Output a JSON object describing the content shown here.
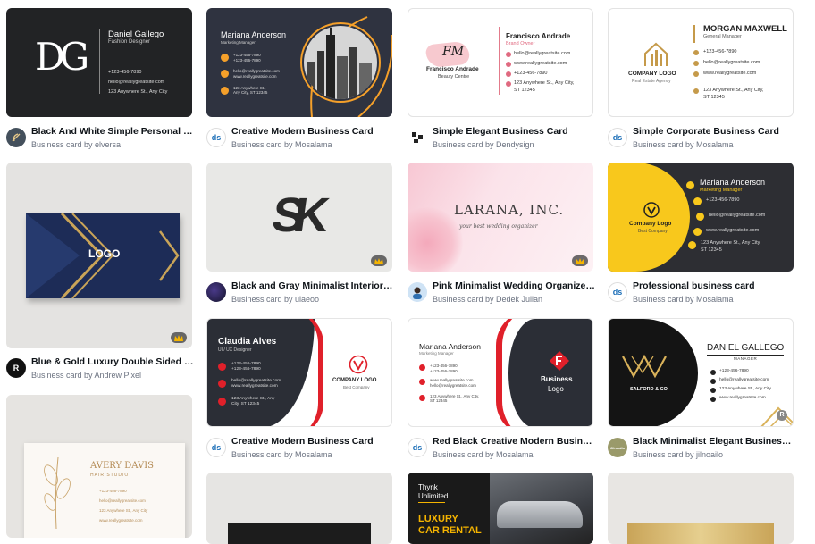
{
  "cards": [
    {
      "title": "Black And White Simple Personal Bu...",
      "byline": "Business card by elversa",
      "avatar": "elversa-avatar"
    },
    {
      "title": "Creative Modern Business Card",
      "byline": "Business card by Mosalama",
      "avatar": "ds-avatar"
    },
    {
      "title": "Simple Elegant Business Card",
      "byline": "Business card by Dendysign",
      "avatar": "dendysign-avatar"
    },
    {
      "title": "Simple Corporate Business Card",
      "byline": "Business card by Mosalama",
      "avatar": "ds-avatar"
    },
    {
      "title": "Blue & Gold Luxury Double Sided Bu...",
      "byline": "Business card by Andrew Pixel",
      "avatar": "r-avatar"
    },
    {
      "title": "Black and Gray Minimalist Interior D...",
      "byline": "Business card by uiaeoo",
      "avatar": "uiaeoo-avatar"
    },
    {
      "title": "Pink Minimalist Wedding Organizer ...",
      "byline": "Business card by Dedek Julian",
      "avatar": "dedek-avatar"
    },
    {
      "title": "Professional business card",
      "byline": "Business card by Mosalama",
      "avatar": "ds-avatar"
    },
    {
      "title": "Creative Modern Business Card",
      "byline": "Business card by Mosalama",
      "avatar": "ds-avatar"
    },
    {
      "title": "Red Black Creative Modern Business...",
      "byline": "Business card by Mosalama",
      "avatar": "ds-avatar"
    },
    {
      "title": "Black Minimalist Elegant Business C...",
      "byline": "Business card by jilnoailo",
      "avatar": "jilnoailo-avatar"
    }
  ],
  "avatars": {
    "ds": "ds",
    "r": "R",
    "jil": "Jilnoailo"
  },
  "thumb1": {
    "mono": "DG",
    "name": "Daniel Gallego",
    "role": "Fashion Designer",
    "phone": "+123-456-7890",
    "email": "hello@reallygreatsite.com",
    "addr": "123 Anywhere St., Any City"
  },
  "thumb2": {
    "name": "Mariana Anderson",
    "role": "Marketing Manager",
    "l1": "+123-456-7890",
    "l2": "+123-456-7890",
    "l3": "hello@reallygreatsite.com",
    "l4": "www.reallygreatsite.com",
    "l5": "123 Anywhere St., Any City, ST 12345"
  },
  "thumb3": {
    "mono": "FM",
    "brand": "Francisco Andrade",
    "tag": "Beauty Centre",
    "name": "Francisco Andrade",
    "role": "Brand Owner",
    "email": "hello@reallygreatsite.com",
    "web": "www.reallygreatsite.com",
    "phone": "+123-456-7890",
    "addr1": "123 Anywhere St., Any City,",
    "addr2": "ST 12345"
  },
  "thumb4": {
    "name": "MORGAN MAXWELL",
    "role": "General Manager",
    "logo": "COMPANY LOGO",
    "agency": "Real Estate Agency",
    "phone": "+123-456-7890",
    "email": "hello@reallygreatsite.com",
    "web": "www.reallygreatsite.com",
    "addr1": "123 Anywhere St., Any City,",
    "addr2": "ST 12345"
  },
  "thumb5": {
    "logo": "LOGO"
  },
  "thumb6": {
    "mono": "SK"
  },
  "thumb7": {
    "title": "LARANA, INC.",
    "tag": "your best wedding organizer"
  },
  "thumb8": {
    "name": "Mariana Anderson",
    "role": "Marketing Manager",
    "logo": "Company Logo",
    "tag": "Best Company",
    "phone": "+123-456-7890",
    "email": "hello@reallygreatsite.com",
    "web": "www.reallygreatsite.com",
    "addr1": "123 Anywhere St., Any City,",
    "addr2": "ST 12345"
  },
  "thumb9": {
    "name": "Claudia Alves",
    "role": "UI / UX Designer",
    "p1": "+123-456-7890",
    "p2": "+123-456-7890",
    "e1": "hello@reallygreatsite.com",
    "e2": "www.reallygreatsite.com",
    "addr1": "123 Anywhere St., Any",
    "addr2": "City, ST 12345",
    "logo": "COMPANY LOGO",
    "tag": "Best Company"
  },
  "thumb10": {
    "name": "Mariana Anderson",
    "role": "Marketing Manager",
    "l1": "+123-456-7890",
    "l2": "+123-456-7890",
    "l3": "www.reallygreatsite.com",
    "l4": "hello@reallygreatsite.com",
    "l5": "123 Anywhere St., Any City, ST 12345",
    "logo1": "Business",
    "logo2": "Logo"
  },
  "thumb11": {
    "brand": "SALFORD & CO.",
    "name": "DANIEL GALLEGO",
    "role": "MANAGER",
    "l1": "+123-456-7890",
    "l2": "hello@reallygreatsite.com",
    "l3": "123 Anywhere St., Any City",
    "l4": "www.reallygreatsite.com",
    "badge": "R"
  },
  "thumb12": {
    "name": "AVERY DAVIS",
    "studio": "HAIR STUDIO",
    "l1": "+123-456-7890",
    "l2": "hello@reallygreatsite.com",
    "l3": "123 Anywhere St., Any City",
    "l4": "www.reallygreatsite.com"
  },
  "thumb13": {
    "t1": "Thynk",
    "t2": "Unlimited",
    "t3": "LUXURY",
    "t4": "CAR RENTAL"
  }
}
